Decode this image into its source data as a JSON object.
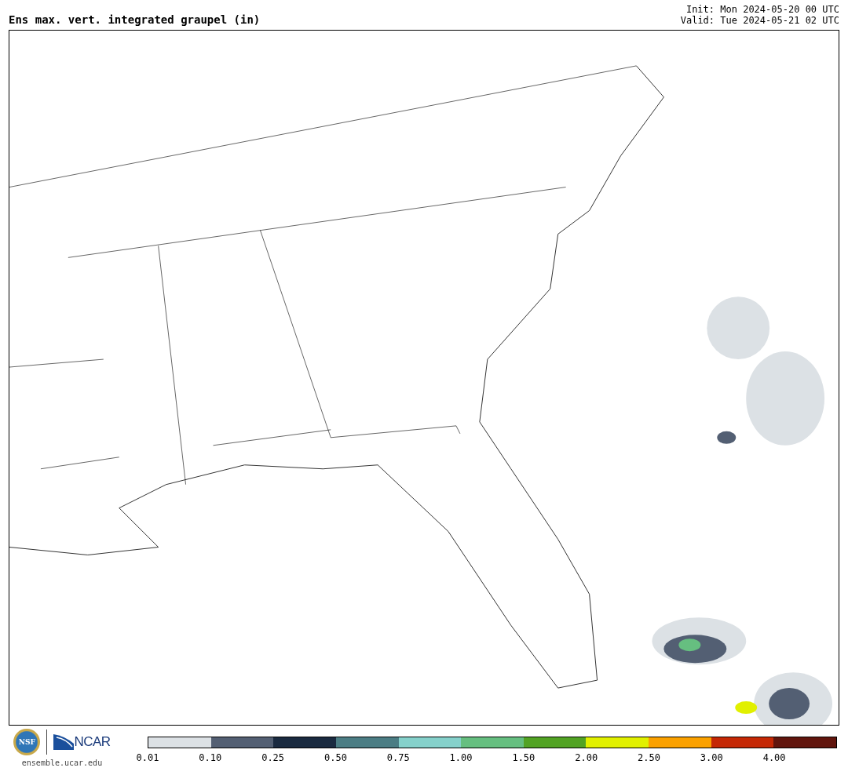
{
  "title": "Ens max. vert. integrated graupel (in)",
  "init": "Init: Mon 2024-05-20 00 UTC",
  "valid": "Valid: Tue 2024-05-21 02 UTC",
  "logos": {
    "nsf": "NSF",
    "ncar": "NCAR",
    "url": "ensemble.ucar.edu"
  },
  "colorbar": [
    {
      "color": "#dce1e5",
      "label": "0.01"
    },
    {
      "color": "#535f73",
      "label": "0.10"
    },
    {
      "color": "#1a2a40",
      "label": "0.25"
    },
    {
      "color": "#4b7d84",
      "label": "0.50"
    },
    {
      "color": "#85d1cb",
      "label": "0.75"
    },
    {
      "color": "#66bf80",
      "label": "1.00"
    },
    {
      "color": "#52a323",
      "label": "1.50"
    },
    {
      "color": "#e1f000",
      "label": "2.00"
    },
    {
      "color": "#fba100",
      "label": "2.50"
    },
    {
      "color": "#c52805",
      "label": "3.00"
    },
    {
      "color": "#61150d",
      "label": "4.00"
    }
  ]
}
